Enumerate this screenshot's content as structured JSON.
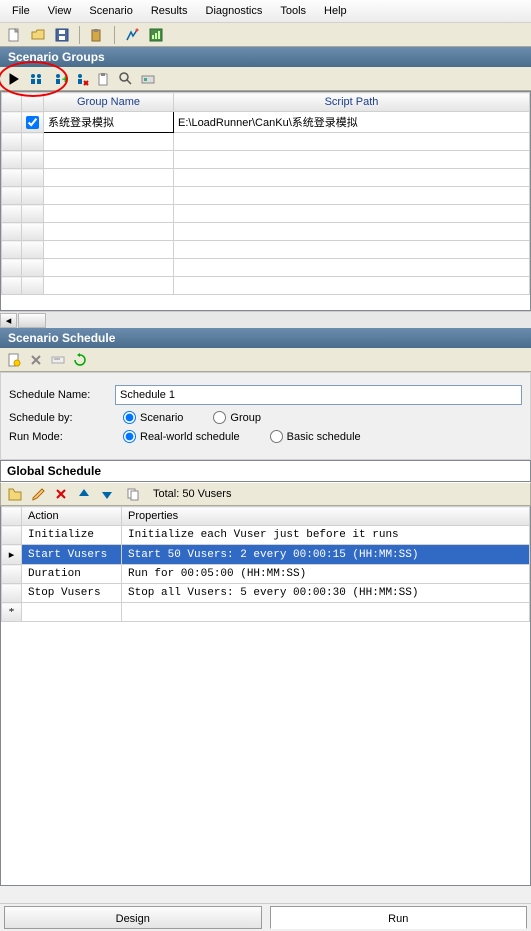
{
  "menu": [
    "File",
    "View",
    "Scenario",
    "Results",
    "Diagnostics",
    "Tools",
    "Help"
  ],
  "sections": {
    "groups_title": "Scenario Groups",
    "schedule_title": "Scenario Schedule",
    "global_title": "Global Schedule"
  },
  "groups_grid": {
    "headers": {
      "group_name": "Group Name",
      "script_path": "Script Path"
    },
    "rows": [
      {
        "checked": true,
        "name": "系统登录模拟",
        "path": "E:\\LoadRunner\\CanKu\\系统登录模拟"
      }
    ]
  },
  "schedule": {
    "name_label": "Schedule Name:",
    "name_value": "Schedule 1",
    "by_label": "Schedule by:",
    "by_options": {
      "scenario": "Scenario",
      "group": "Group"
    },
    "by_selected": "scenario",
    "mode_label": "Run Mode:",
    "mode_options": {
      "real": "Real-world schedule",
      "basic": "Basic schedule"
    },
    "mode_selected": "real",
    "vusers_total_label": "Total: 50 Vusers"
  },
  "global_grid": {
    "headers": {
      "action": "Action",
      "properties": "Properties"
    },
    "rows": [
      {
        "action": "Initialize",
        "properties": "Initialize each Vuser just before it runs",
        "selected": false
      },
      {
        "action": "Start  Vusers",
        "properties": "Start 50 Vusers: 2 every 00:00:15 (HH:MM:SS)",
        "selected": true
      },
      {
        "action": "Duration",
        "properties": "Run for 00:05:00 (HH:MM:SS)",
        "selected": false
      },
      {
        "action": "Stop Vusers",
        "properties": "Stop all Vusers: 5 every 00:00:30 (HH:MM:SS)",
        "selected": false
      }
    ],
    "new_row_marker": "*"
  },
  "tabs": {
    "design": "Design",
    "run": "Run",
    "active": "run"
  }
}
